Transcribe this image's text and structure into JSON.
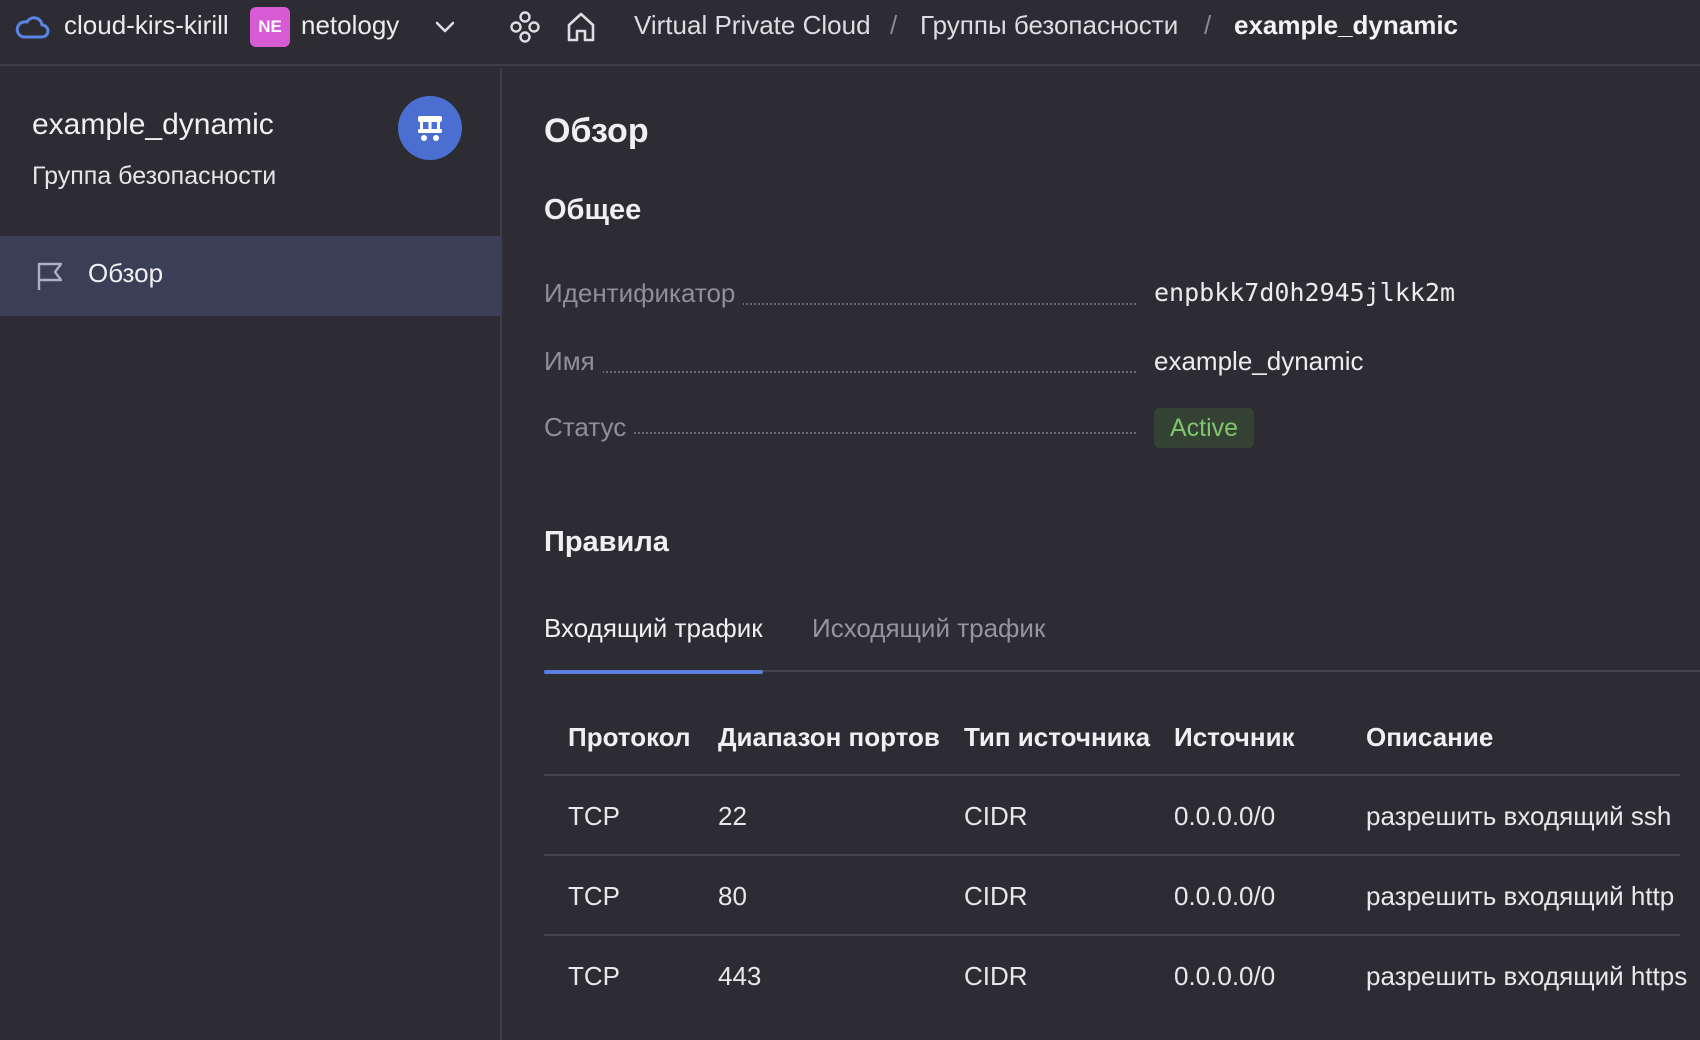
{
  "topbar": {
    "cloud_name": "cloud-kirs-kirill",
    "org_badge": "NE",
    "org_name": "netology",
    "breadcrumbs": [
      "Virtual Private Cloud",
      "Группы безопасности",
      "example_dynamic"
    ],
    "separator": "/"
  },
  "sidebar": {
    "title": "example_dynamic",
    "subtitle": "Группа безопасности",
    "items": [
      {
        "label": "Обзор",
        "active": true
      }
    ]
  },
  "main": {
    "title": "Обзор",
    "general_heading": "Общее",
    "props": {
      "id_label": "Идентификатор",
      "id_value": "enpbkk7d0h2945jlkk2m",
      "name_label": "Имя",
      "name_value": "example_dynamic",
      "status_label": "Статус",
      "status_value": "Active"
    },
    "rules_heading": "Правила",
    "tabs": [
      {
        "label": "Входящий трафик",
        "active": true
      },
      {
        "label": "Исходящий трафик",
        "active": false
      }
    ],
    "table": {
      "headers": [
        "Протокол",
        "Диапазон портов",
        "Тип источника",
        "Источник",
        "Описание"
      ],
      "rows": [
        [
          "TCP",
          "22",
          "CIDR",
          "0.0.0.0/0",
          "разрешить входящий ssh"
        ],
        [
          "TCP",
          "80",
          "CIDR",
          "0.0.0.0/0",
          "разрешить входящий http"
        ],
        [
          "TCP",
          "443",
          "CIDR",
          "0.0.0.0/0",
          "разрешить входящий https"
        ]
      ]
    }
  },
  "colors": {
    "background": "#2c2c32",
    "accent": "#5a7fe0",
    "status_active": "#7fc56e",
    "org_badge": "#d75bd4",
    "avatar": "#4b6fd1"
  },
  "icons": [
    "cloud-icon",
    "chevron-down-icon",
    "nodes-icon",
    "home-icon",
    "network-icon",
    "flag-icon"
  ]
}
